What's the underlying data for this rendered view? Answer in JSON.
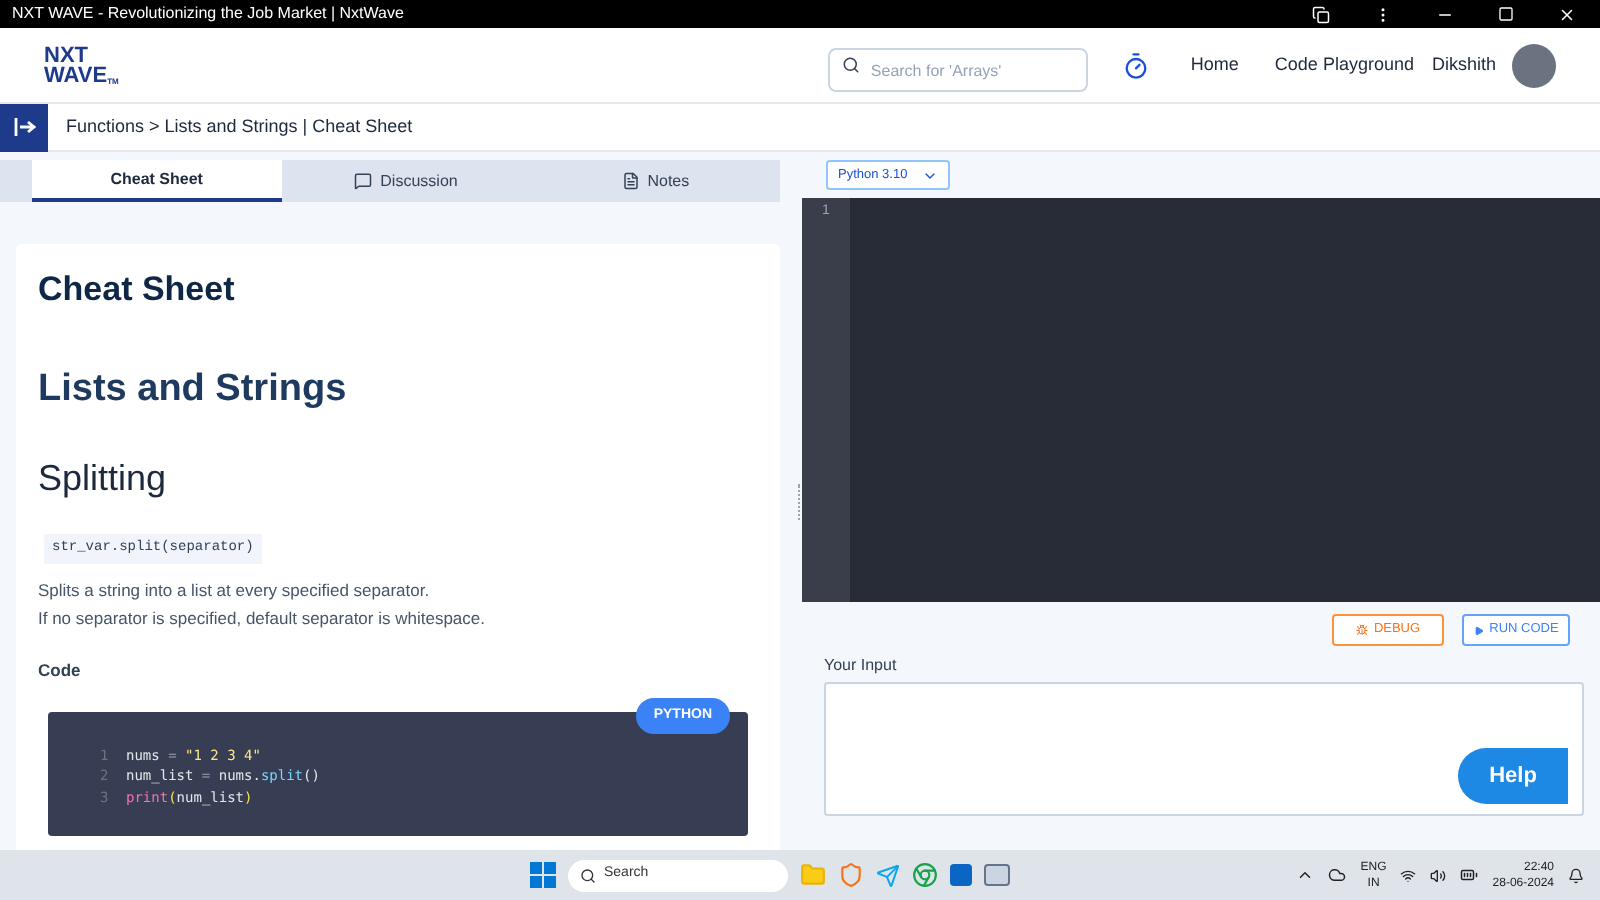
{
  "window": {
    "title": "NXT WAVE - Revolutionizing the Job Market | NxtWave"
  },
  "header": {
    "logo": [
      "NXT",
      "WAVE",
      "TM"
    ],
    "search": {
      "placeholder": "Search for 'Arrays'"
    },
    "nav": [
      "Home",
      "Code Playground"
    ],
    "user": "Dikshith"
  },
  "breadcrumb": "Functions > Lists and Strings | Cheat Sheet",
  "tabs": [
    {
      "label": "Cheat Sheet",
      "selected": true,
      "kind": "plain"
    },
    {
      "label": "Discussion",
      "selected": false,
      "kind": "chat"
    },
    {
      "label": "Notes",
      "selected": false,
      "kind": "notes"
    }
  ],
  "article": {
    "title": "Cheat Sheet",
    "heading": "Lists and Strings",
    "subheading": "Splitting",
    "syntax": "str_var.split(separator)",
    "paragraphs": [
      "Splits a string into a list at every specified separator.",
      "If no separator is specified, default separator is whitespace."
    ],
    "code_label": "Code",
    "language": "PYTHON",
    "code_lines": [
      {
        "number": "1",
        "tokens": [
          {
            "text": "nums",
            "kind": "name"
          },
          {
            "text": " = ",
            "kind": "op"
          },
          {
            "text": "\"1 2 3 4\"",
            "kind": "string"
          }
        ]
      },
      {
        "number": "2",
        "tokens": [
          {
            "text": "num_list",
            "kind": "name"
          },
          {
            "text": " = ",
            "kind": "op"
          },
          {
            "text": "nums.",
            "kind": "name"
          },
          {
            "text": "split",
            "kind": "func"
          },
          {
            "text": "()",
            "kind": "name"
          }
        ]
      },
      {
        "number": "3",
        "tokens": [
          {
            "text": "print",
            "kind": "builtin"
          },
          {
            "text": "(",
            "kind": "paren"
          },
          {
            "text": "num_list",
            "kind": "name"
          },
          {
            "text": ")",
            "kind": "paren"
          }
        ]
      }
    ]
  },
  "editor": {
    "version": "Python 3.10",
    "line_numbers": [
      "1"
    ],
    "debug": "DEBUG",
    "run": "RUN CODE",
    "input_label": "Your Input",
    "help": "Help"
  },
  "taskbar": {
    "search": "Search",
    "lang": "ENG",
    "region": "IN",
    "time": "22:40",
    "date": "28-06-2024"
  }
}
